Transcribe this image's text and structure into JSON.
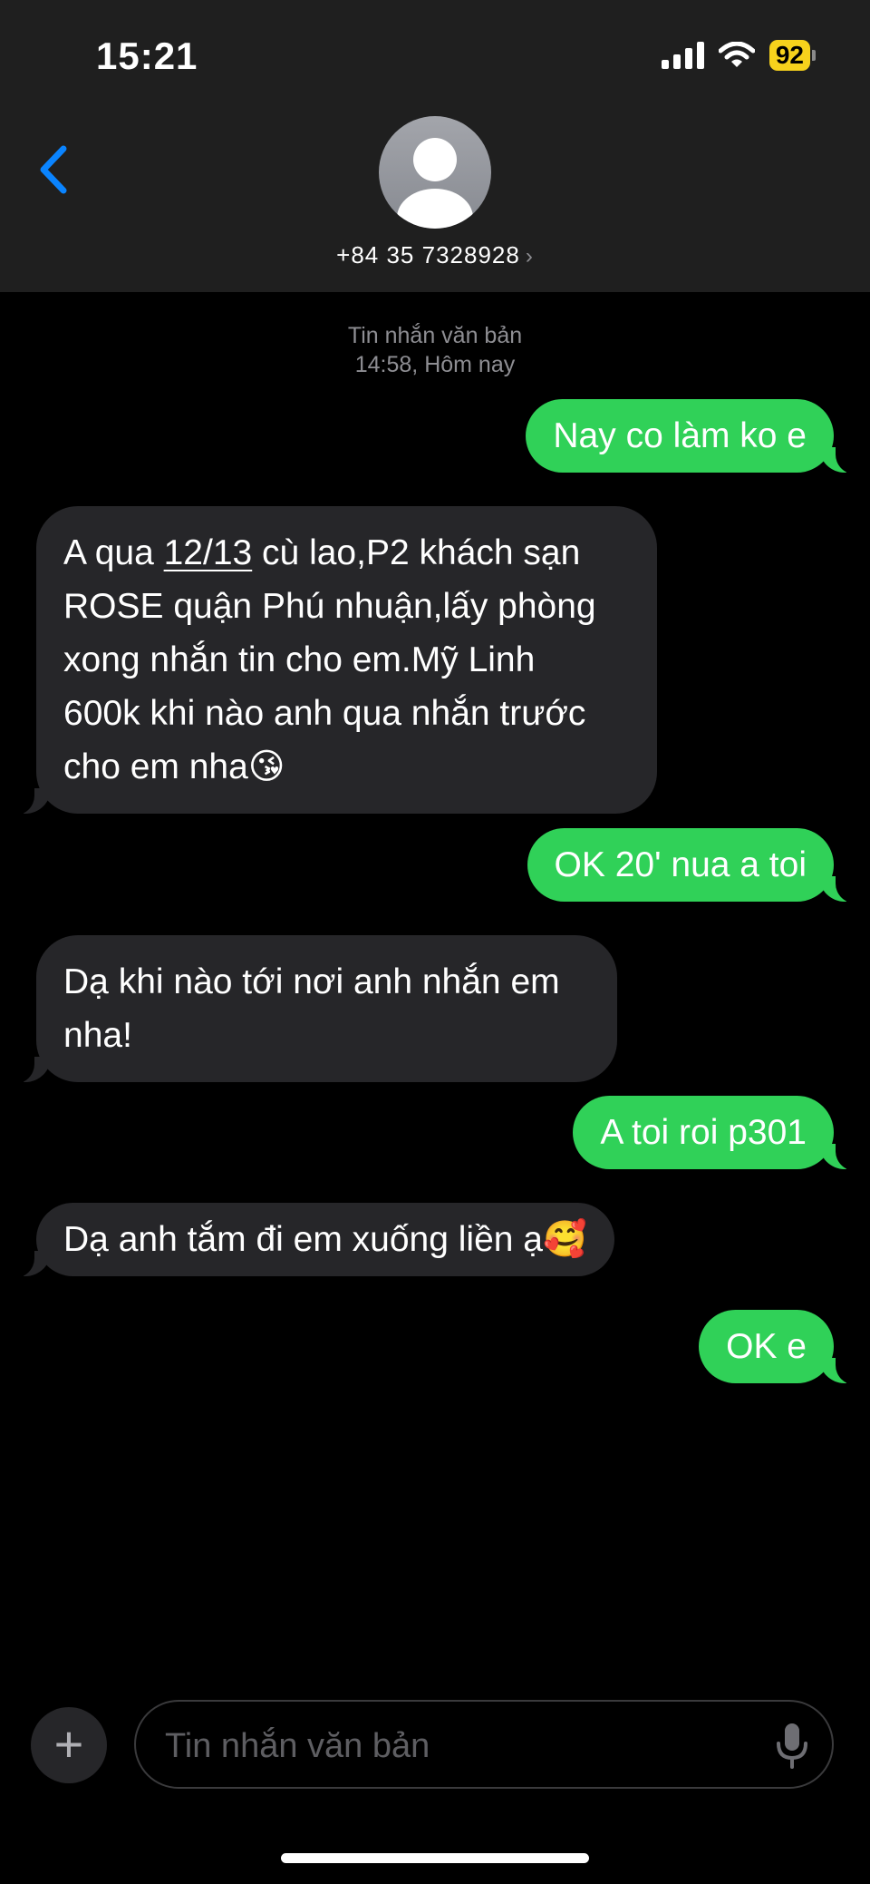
{
  "status_bar": {
    "time": "15:21",
    "battery": "92"
  },
  "contact": {
    "phone": "+84 35 7328928",
    "chevron": "›"
  },
  "thread_meta": {
    "type_label": "Tin nhắn văn bản",
    "timestamp": "14:58, Hôm nay"
  },
  "messages": [
    {
      "direction": "sent",
      "text": "Nay co làm ko e"
    },
    {
      "direction": "received",
      "lines": [
        "A qua ",
        "12/13",
        " cù lao,P2 khách sạn",
        "ROSE quận Phú nhuận,lấy phòng",
        "xong nhắn tin cho em.Mỹ Linh",
        "600k khi nào anh qua nhắn trước",
        "cho em nha😘"
      ]
    },
    {
      "direction": "sent",
      "text": "OK 20' nua a toi"
    },
    {
      "direction": "received",
      "lines": [
        "Dạ khi nào tới nơi anh nhắn em",
        "nha!"
      ]
    },
    {
      "direction": "sent",
      "text": "A toi roi p301"
    },
    {
      "direction": "received",
      "text": "Dạ anh tắm đi em xuống liền ạ🥰"
    },
    {
      "direction": "sent",
      "text": "OK e"
    }
  ],
  "composer": {
    "placeholder": "Tin nhắn văn bản",
    "plus": "+"
  },
  "icons": {
    "back": "chevron-left-icon",
    "avatar": "person-icon",
    "signal": "cellular-signal-icon",
    "wifi": "wifi-icon",
    "battery": "battery-icon",
    "mic": "microphone-icon",
    "plus": "plus-icon"
  },
  "colors": {
    "sent_bubble": "#30d158",
    "received_bubble": "#262629",
    "header_bg": "#1f1f1f",
    "accent": "#0a84ff",
    "battery": "#f7d21c",
    "meta_text": "#8e8e93"
  }
}
